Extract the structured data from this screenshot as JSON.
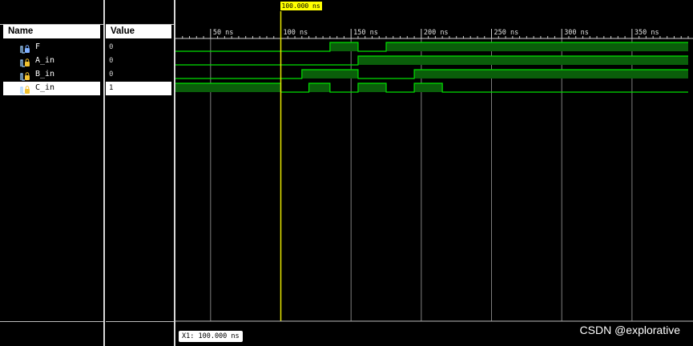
{
  "panels": {
    "name_header": "Name",
    "value_header": "Value"
  },
  "signals": [
    {
      "name": "F",
      "value": "0",
      "icon": "signal-output-icon",
      "selected": false,
      "transitions": [
        [
          0,
          0
        ],
        [
          135,
          1
        ],
        [
          155,
          0
        ],
        [
          175,
          1
        ]
      ]
    },
    {
      "name": "A_in",
      "value": "0",
      "icon": "signal-input-icon",
      "selected": false,
      "transitions": [
        [
          0,
          0
        ],
        [
          155,
          1
        ]
      ]
    },
    {
      "name": "B_in",
      "value": "0",
      "icon": "signal-input-icon",
      "selected": false,
      "transitions": [
        [
          0,
          0
        ],
        [
          115,
          1
        ],
        [
          155,
          0
        ],
        [
          195,
          1
        ]
      ]
    },
    {
      "name": "C_in",
      "value": "1",
      "icon": "signal-input-icon",
      "selected": true,
      "transitions": [
        [
          0,
          1
        ],
        [
          100,
          0
        ],
        [
          120,
          1
        ],
        [
          135,
          0
        ],
        [
          155,
          1
        ],
        [
          175,
          0
        ],
        [
          195,
          1
        ],
        [
          215,
          0
        ]
      ]
    }
  ],
  "timeline": {
    "unit": "ns",
    "t_start": 25,
    "t_end": 390,
    "major_ticks": [
      50,
      100,
      150,
      200,
      250,
      300,
      350
    ],
    "tick_labels": [
      "50 ns",
      "100 ns",
      "150 ns",
      "200 ns",
      "250 ns",
      "300 ns",
      "350 ns"
    ]
  },
  "cursor": {
    "time": 100,
    "label": "100.000 ns",
    "readout": "X1: 100.000 ns"
  },
  "colors": {
    "wave": "#00e000",
    "wave_fill": "#0a5e0a",
    "cursor": "#e8e800",
    "grid": "#7f7f7f",
    "ruler": "#d0d0d0"
  },
  "watermark": "CSDN @explorative"
}
